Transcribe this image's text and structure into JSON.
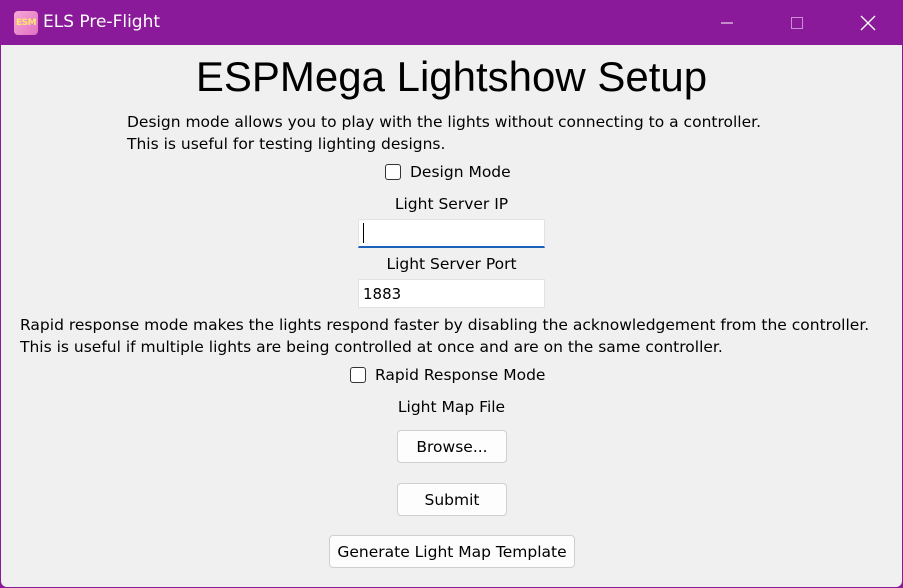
{
  "window": {
    "title": "ELS Pre-Flight",
    "app_icon_text": "ESM"
  },
  "main": {
    "heading": "ESPMega Lightshow Setup",
    "design_info": [
      "Design mode allows you to play with the lights without connecting to a controller.",
      "This is useful for testing lighting designs."
    ],
    "design_mode_label": "Design Mode",
    "design_mode_checked": false,
    "ip_label": "Light Server IP",
    "ip_value": "",
    "port_label": "Light Server Port",
    "port_value": "1883",
    "rapid_info": [
      "Rapid response mode makes the lights respond faster by disabling the acknowledgement from the controller.",
      "This is useful if multiple lights are being controlled at once and are on the same controller."
    ],
    "rapid_mode_label": "Rapid Response Mode",
    "rapid_mode_checked": false,
    "map_label": "Light Map File",
    "browse_label": "Browse...",
    "submit_label": "Submit",
    "generate_label": "Generate Light Map Template"
  },
  "colors": {
    "titlebar": "#8b1a9a",
    "client_bg": "#f0f0f0",
    "focus_accent": "#1a62b8"
  }
}
